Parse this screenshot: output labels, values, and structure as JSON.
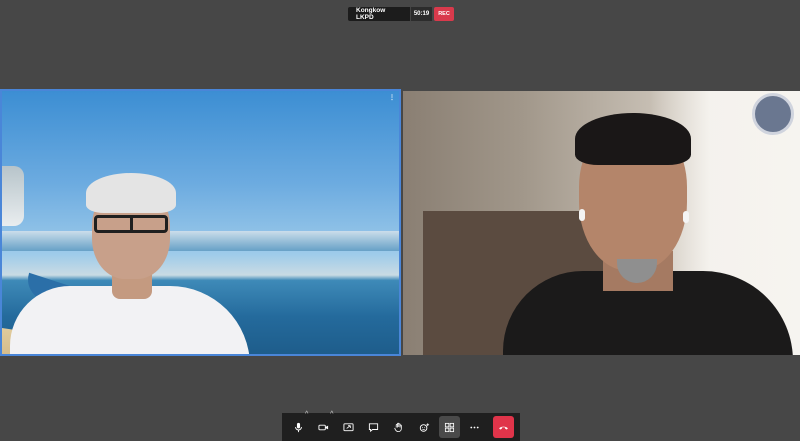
{
  "meeting": {
    "title": "Kongkow LKPD",
    "timer": "50:19",
    "recording_label": "REC"
  },
  "tiles": [
    {
      "id": "left",
      "speaking": true,
      "menu_glyph": "⋮"
    },
    {
      "id": "right",
      "speaking": false
    }
  ],
  "toolbar": {
    "buttons": [
      {
        "icon": "microphone-icon",
        "has_options": true
      },
      {
        "icon": "camera-icon",
        "has_options": true
      },
      {
        "icon": "share-screen-icon"
      },
      {
        "icon": "chat-icon"
      },
      {
        "icon": "raise-hand-icon"
      },
      {
        "icon": "reactions-icon"
      },
      {
        "icon": "grid-layout-icon",
        "active": true
      },
      {
        "icon": "more-options-icon"
      },
      {
        "icon": "end-call-icon",
        "color": "#e0344a"
      }
    ],
    "caret_glyph": "^"
  },
  "colors": {
    "background": "#474747",
    "active_speaker_border": "#4a86d8",
    "rec": "#d93a4c",
    "end_call": "#e0344a"
  }
}
